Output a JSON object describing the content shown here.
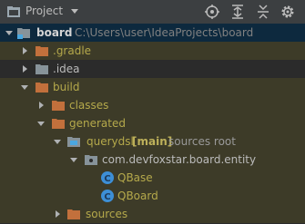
{
  "header": {
    "title": "Project",
    "icons": [
      "project-icon",
      "dropdown-icon",
      "locate-icon",
      "expand-all-icon",
      "collapse-all-icon",
      "settings-icon"
    ]
  },
  "tree": {
    "root": {
      "name": "board",
      "path": "C:\\Users\\user\\IdeaProjects\\board"
    },
    "gradle": ".gradle",
    "idea": ".idea",
    "build": "build",
    "classes": "classes",
    "generated": "generated",
    "querydsl": {
      "name": "querydsl",
      "module": "[main]",
      "suffix": "sources root"
    },
    "package": "com.devfoxstar.board.entity",
    "qbase": "QBase",
    "qboard": "QBoard",
    "sources": "sources"
  },
  "colors": {
    "background": "#2b2b2b",
    "header": "#3c3f41",
    "selection": "#0d293e",
    "excluded_row": "#3d3b28",
    "excluded_folder": "#c2703c",
    "class_icon": "#3d8fd6"
  }
}
